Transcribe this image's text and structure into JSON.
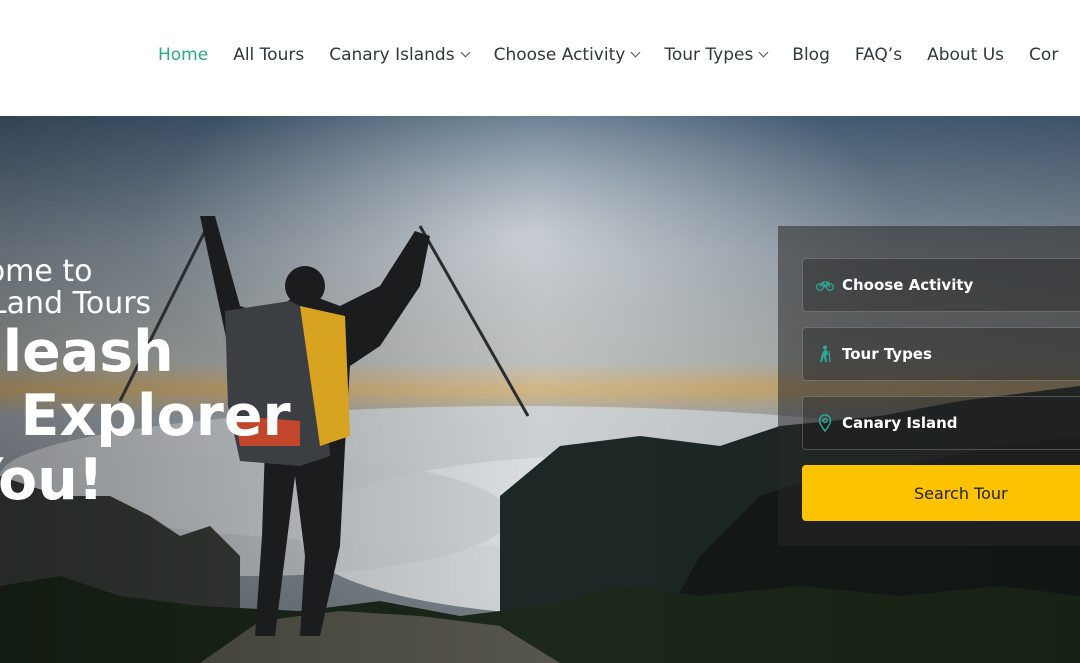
{
  "nav": {
    "items": [
      {
        "label": "Home",
        "dropdown": false,
        "active": true
      },
      {
        "label": "All Tours",
        "dropdown": false,
        "active": false
      },
      {
        "label": "Canary Islands",
        "dropdown": true,
        "active": false
      },
      {
        "label": "Choose Activity",
        "dropdown": true,
        "active": false
      },
      {
        "label": "Tour Types",
        "dropdown": true,
        "active": false
      },
      {
        "label": "Blog",
        "dropdown": false,
        "active": false
      },
      {
        "label": "FAQ’s",
        "dropdown": false,
        "active": false
      },
      {
        "label": "About Us",
        "dropdown": false,
        "active": false
      },
      {
        "label": "Cor",
        "dropdown": false,
        "active": false
      }
    ]
  },
  "hero": {
    "welcome_line1": "lcome to",
    "welcome_line2": "a Land Tours",
    "headline_line1": "nleash",
    "headline_line2": "e Explorer",
    "headline_line3": "You!"
  },
  "search": {
    "activity_label": "Choose Activity",
    "tour_types_label": "Tour Types",
    "island_label": "Canary Island",
    "button_label": "Search Tour"
  },
  "colors": {
    "accent": "#2ea793",
    "button": "#fdc300",
    "nav_text": "#2f3a3e"
  },
  "icons": {
    "activity": "bicycle-icon",
    "tour_types": "hiker-icon",
    "island": "map-pin-icon"
  }
}
